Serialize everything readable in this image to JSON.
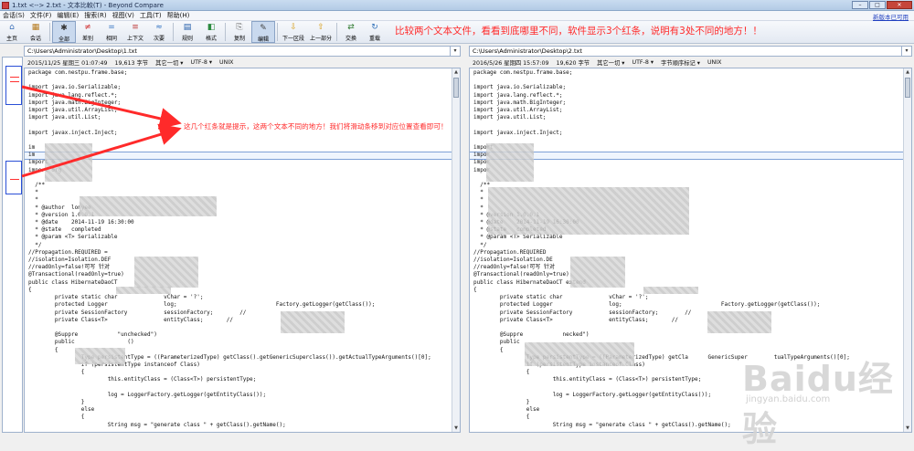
{
  "window": {
    "title": "1.txt <--> 2.txt - 文本比較(T) - Beyond Compare",
    "controls": [
      "–",
      "□",
      "✕"
    ]
  },
  "menu": {
    "items": [
      "会话(S)",
      "文件(F)",
      "编辑(E)",
      "搜索(R)",
      "视图(V)",
      "工具(T)",
      "帮助(H)"
    ],
    "new_version": "新版本已可用"
  },
  "toolbar": {
    "buttons": [
      {
        "label": "主页",
        "icon": "home-icon"
      },
      {
        "label": "会话",
        "icon": "session-icon"
      },
      {
        "label": "全部",
        "icon": "all-icon"
      },
      {
        "label": "差别",
        "icon": "diff-icon"
      },
      {
        "label": "相同",
        "icon": "same-icon"
      },
      {
        "label": "上下文",
        "icon": "context-icon"
      },
      {
        "label": "次要",
        "icon": "minor-icon"
      },
      {
        "label": "规则",
        "icon": "rules-icon"
      },
      {
        "label": "格式",
        "icon": "format-icon"
      },
      {
        "label": "复制",
        "icon": "copy-icon"
      },
      {
        "label": "编辑",
        "icon": "edit-icon"
      },
      {
        "label": "下一区段",
        "icon": "next-section-icon"
      },
      {
        "label": "上一部分",
        "icon": "prev-section-icon"
      },
      {
        "label": "交换",
        "icon": "swap-icon"
      },
      {
        "label": "重载",
        "icon": "reload-icon"
      }
    ]
  },
  "annotations": {
    "top": "比较两个文本文件，看看到底哪里不同，软件显示3个红条，说明有3处不同的地方！！",
    "mid": "这几个红条就是提示，这两个文本不同的地方！我们将滑动条移到对应位置查看即可！",
    "color": "#ff2a2a"
  },
  "left": {
    "path": "C:\\Users\\Administrator\\Desktop\\1.txt",
    "info": [
      "2015/11/25 星期三 01:07:49",
      "19,613 字节",
      "其它一切",
      "UTF-8",
      "UNIX"
    ],
    "code": "package com.nestpu.frame.base;\n\nimport java.io.Serializable;\nimport java.lang.reflect.*;\nimport java.math.BigInteger;\nimport java.util.ArrayList;\nimport java.util.List;\n\nimport javax.inject.Inject;\n\nim\nim\nimport o\nimport org\n\n  /**\n  *\n  *\n  * @author  lonyee\n  * @version 1.0.0.1\n  * @date    2014-11-19 16:30:00\n  * @state   completed\n  * @param <T> Serializable\n  */\n//Propagation.REQUIRED =\n//isolation=Isolation.DEF\n//readOnly=false!可写 针对\n@Transactional(readOnly=true)\npublic class HibernateDaoCT\n{\n        private static char              vChar = '?';\n        protected Logger                 log;                              Factory.getLogger(getClass());\n        private SessionFactory           sessionFactory;        //\n        private Class<T>                 entityClass;       //\n\n        @Suppre            \"unchecked\")\n        public                ()\n        {\n                Type persistentType = ((ParameterizedType) getClass().getGenericSuperclass()).getActualTypeArguments()[0];\n                if (persistentType instanceof Class)\n                {\n                        this.entityClass = (Class<T>) persistentType;\n\n                        log = LoggerFactory.getLogger(getEntityClass());\n                }\n                else\n                {\n                        String msg = \"generate class \" + getClass().getName();"
  },
  "right": {
    "path": "C:\\Users\\Administrator\\Desktop\\2.txt",
    "info": [
      "2016/5/26 星期四 15:57:09",
      "19,620 字节",
      "其它一切",
      "UTF-8",
      "字节顺序标记",
      "UNIX"
    ],
    "code": "package com.nestpu.frame.base;\n\nimport java.io.Serializable;\nimport java.lang.reflect.*;\nimport java.math.BigInteger;\nimport java.util.ArrayList;\nimport java.util.List;\n\nimport javax.inject.Inject;\n\nimport\nimpor\nimpor\nimpor\n\n  /**\n  *\n  *\n  *\n  * @version 1.0.0.1\n  * @date    2014-11-19 16:30:00\n  * @state   completed\n  * @param <T> Serializable\n  */\n//Propagation.REQUIRED\n//isolation=Isolation.DE\n//readOnly=false!可写 针对\n@Transactional(readOnly=true)\npublic class HibernateDaoCT extend\n{\n        private static char              vChar = '?';\n        protected Logger                 log;                              Factory.getLogger(getClass());\n        private SessionFactory           sessionFactory;        //\n        private Class<T>                 entityClass;       //\n\n        @Suppre            necked\")\n        public\n        {\n                Type persistentType = ((ParameterizedType) getCla      GenericSuper        tualTypeArguments()[0];\n                if (persistentType instanceof Class)\n                {\n                        this.entityClass = (Class<T>) persistentType;\n\n                        log = LoggerFactory.getLogger(getEntityClass());\n                }\n                else\n                {\n                        String msg = \"generate class \" + getClass().getName();"
  },
  "watermark": {
    "logo": "Baidu经验",
    "url": "jingyan.baidu.com"
  }
}
